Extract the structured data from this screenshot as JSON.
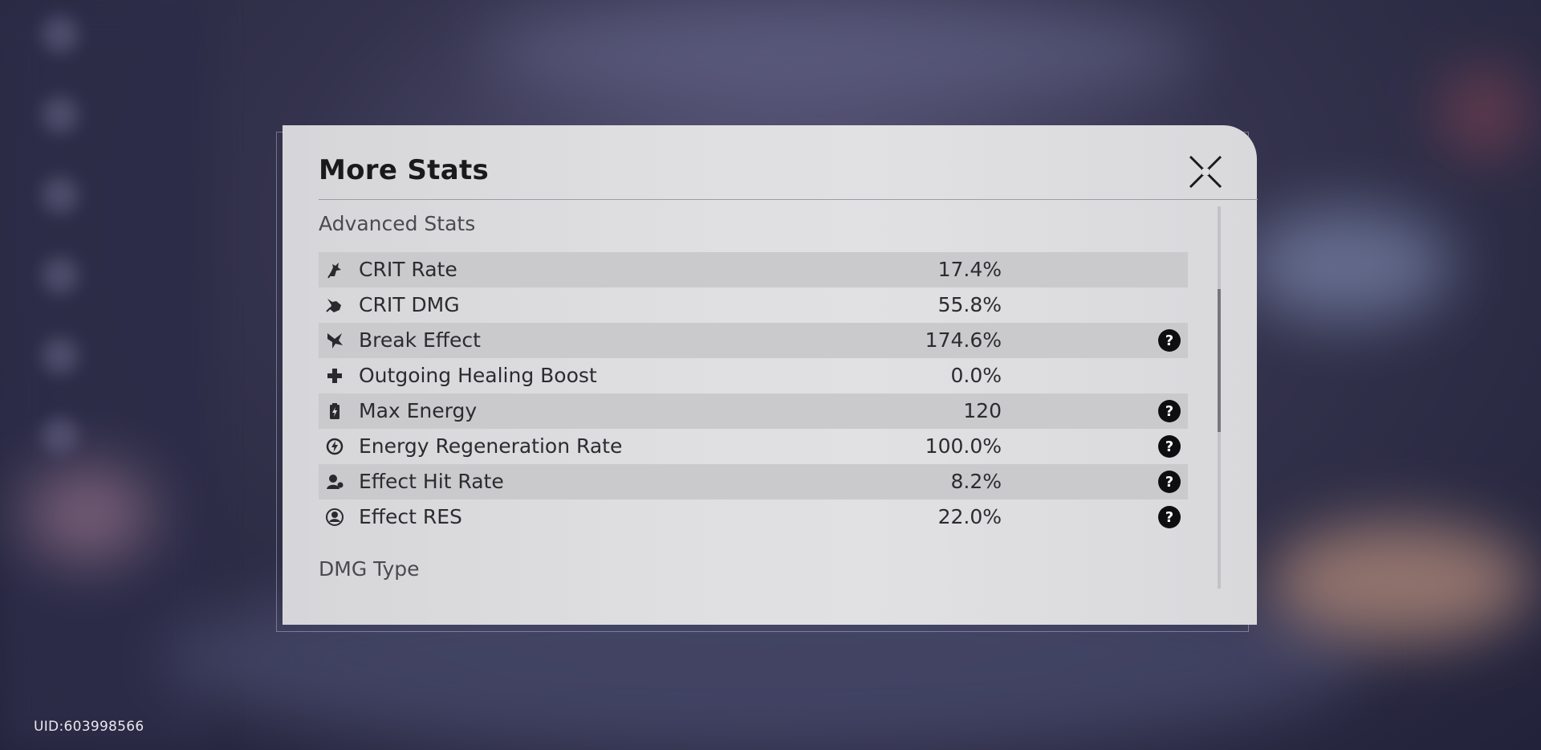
{
  "dialog": {
    "title": "More Stats"
  },
  "sections": {
    "advanced_stats": "Advanced Stats",
    "dmg_type": "DMG Type"
  },
  "stats": [
    {
      "label": "CRIT Rate",
      "value": "17.4%",
      "icon": "crit-rate-icon",
      "help": false
    },
    {
      "label": "CRIT DMG",
      "value": "55.8%",
      "icon": "crit-dmg-icon",
      "help": false
    },
    {
      "label": "Break Effect",
      "value": "174.6%",
      "icon": "break-effect-icon",
      "help": true
    },
    {
      "label": "Outgoing Healing Boost",
      "value": "0.0%",
      "icon": "healing-cross-icon",
      "help": false
    },
    {
      "label": "Max Energy",
      "value": "120",
      "icon": "battery-icon",
      "help": true
    },
    {
      "label": "Energy Regeneration Rate",
      "value": "100.0%",
      "icon": "energy-regen-icon",
      "help": true
    },
    {
      "label": "Effect Hit Rate",
      "value": "8.2%",
      "icon": "effect-hit-icon",
      "help": true
    },
    {
      "label": "Effect RES",
      "value": "22.0%",
      "icon": "effect-res-icon",
      "help": true
    }
  ],
  "footer": {
    "uid": "UID:603998566"
  },
  "colors": {
    "panel": "#dfdfe1",
    "row_shade": "#cacacd",
    "text": "#2c2c30",
    "title": "#1a1a1c"
  }
}
